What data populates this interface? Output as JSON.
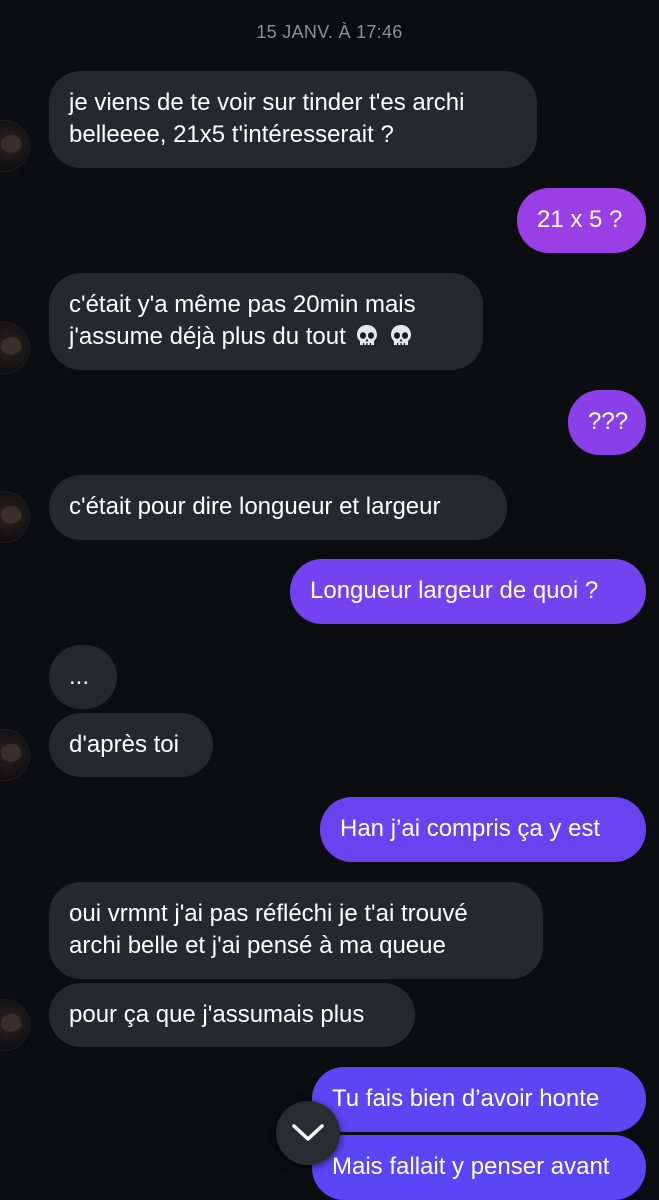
{
  "timestamp": "15 JANV. À 17:46",
  "colors": {
    "incoming_bubble": "#26282c",
    "outgoing_top": "#9b3fe6",
    "outgoing_bottom": "#5b43f5",
    "background": "#0b0d10"
  },
  "messages": [
    {
      "direction": "in",
      "lines": [
        "je viens de te voir sur tinder t'es archi",
        "belleeee, 21x5 t'intéresserait ?"
      ]
    },
    {
      "direction": "out",
      "lines": [
        "21 x 5 ?"
      ]
    },
    {
      "direction": "in",
      "lines": [
        "c'était y'a même pas 20min mais",
        "j'assume déjà plus du tout"
      ],
      "emoji": [
        "skull",
        "skull"
      ]
    },
    {
      "direction": "out",
      "lines": [
        "???"
      ]
    },
    {
      "direction": "in",
      "lines": [
        "c'était pour dire longueur et largeur"
      ]
    },
    {
      "direction": "out",
      "lines": [
        "Longueur largeur de quoi ?"
      ]
    },
    {
      "direction": "in",
      "lines": [
        "..."
      ]
    },
    {
      "direction": "in",
      "lines": [
        "d'après toi"
      ]
    },
    {
      "direction": "out",
      "lines": [
        "Han j’ai compris ça y est"
      ]
    },
    {
      "direction": "in",
      "lines": [
        "oui vrmnt j'ai pas réfléchi je t'ai trouvé",
        "archi belle et j'ai pensé à ma queue"
      ]
    },
    {
      "direction": "in",
      "lines": [
        "pour ça que j'assumais plus"
      ]
    },
    {
      "direction": "out",
      "lines": [
        "Tu fais bien d’avoir honte"
      ]
    },
    {
      "direction": "out",
      "lines": [
        "Mais fallait y penser avant"
      ]
    }
  ],
  "icons": {
    "scroll_down": "chevron-down-icon",
    "avatar": "contact-avatar",
    "emoji": "skull-icon"
  }
}
